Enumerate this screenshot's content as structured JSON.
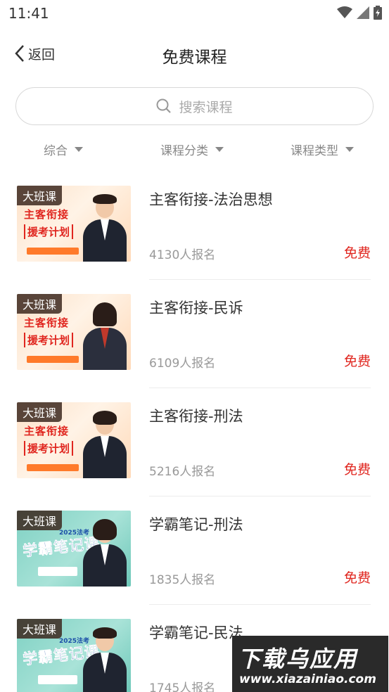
{
  "status_bar": {
    "time": "11:41"
  },
  "header": {
    "back_label": "返回",
    "title": "免费课程"
  },
  "search": {
    "placeholder": "搜索课程"
  },
  "filters": [
    {
      "label": "综合"
    },
    {
      "label": "课程分类"
    },
    {
      "label": "课程类型"
    }
  ],
  "courses": [
    {
      "badge": "大班课",
      "thumb_line1": "主客衔接",
      "thumb_line2": "援考计划",
      "title": "主客衔接-法治思想",
      "count": "4130人报名",
      "price": "免费"
    },
    {
      "badge": "大班课",
      "thumb_line1": "主客衔接",
      "thumb_line2": "援考计划",
      "title": "主客衔接-民诉",
      "count": "6109人报名",
      "price": "免费"
    },
    {
      "badge": "大班课",
      "thumb_line1": "主客衔接",
      "thumb_line2": "援考计划",
      "title": "主客衔接-刑法",
      "count": "5216人报名",
      "price": "免费"
    },
    {
      "badge": "大班课",
      "thumb_year": "2025法考",
      "thumb_head": "学霸笔记课",
      "title": "学霸笔记-刑法",
      "count": "1835人报名",
      "price": "免费"
    },
    {
      "badge": "大班课",
      "thumb_year": "2025法考",
      "thumb_head": "学霸笔记课",
      "title": "学霸笔记-民法",
      "count": "1745人报名",
      "price": "免费"
    }
  ],
  "watermark": {
    "line1": "下载乌应用",
    "line2": "www.xiazainiao.com"
  },
  "colors": {
    "accent_red": "#e0261f",
    "muted_gray": "#999999"
  }
}
